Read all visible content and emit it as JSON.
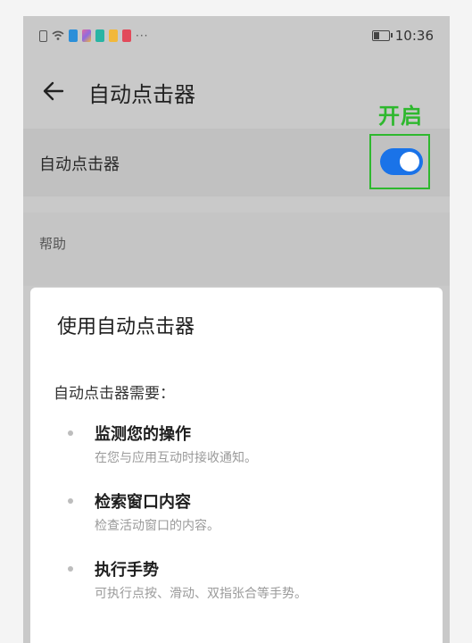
{
  "status_bar": {
    "time": "10:36",
    "battery_level": 0.35,
    "icons": [
      {
        "name": "sim-icon",
        "color": "#ffffff"
      },
      {
        "name": "wifi-icon",
        "color": "#ffffff"
      },
      {
        "name": "app-icon-blue",
        "color": "#2b8fd9"
      },
      {
        "name": "app-icon-multicolor",
        "color": "#e06aa0"
      },
      {
        "name": "app-icon-teal",
        "color": "#28b4a4"
      },
      {
        "name": "app-icon-yellow",
        "color": "#f2b83a"
      },
      {
        "name": "app-icon-red",
        "color": "#e24a5a"
      }
    ],
    "more": "···"
  },
  "header": {
    "title": "自动点击器",
    "back_icon": "arrow-left-icon"
  },
  "annotation": {
    "label": "开启",
    "color": "#2eb82e"
  },
  "setting": {
    "label": "自动点击器",
    "toggle_on": true,
    "toggle_color": "#1a73e8"
  },
  "help": {
    "label": "帮助"
  },
  "dialog": {
    "title": "使用自动点击器",
    "intro": "自动点击器需要：",
    "permissions": [
      {
        "title": "监测您的操作",
        "desc": "在您与应用互动时接收通知。"
      },
      {
        "title": "检索窗口内容",
        "desc": "检查活动窗口的内容。"
      },
      {
        "title": "执行手势",
        "desc": "可执行点按、滑动、双指张合等手势。"
      }
    ]
  }
}
